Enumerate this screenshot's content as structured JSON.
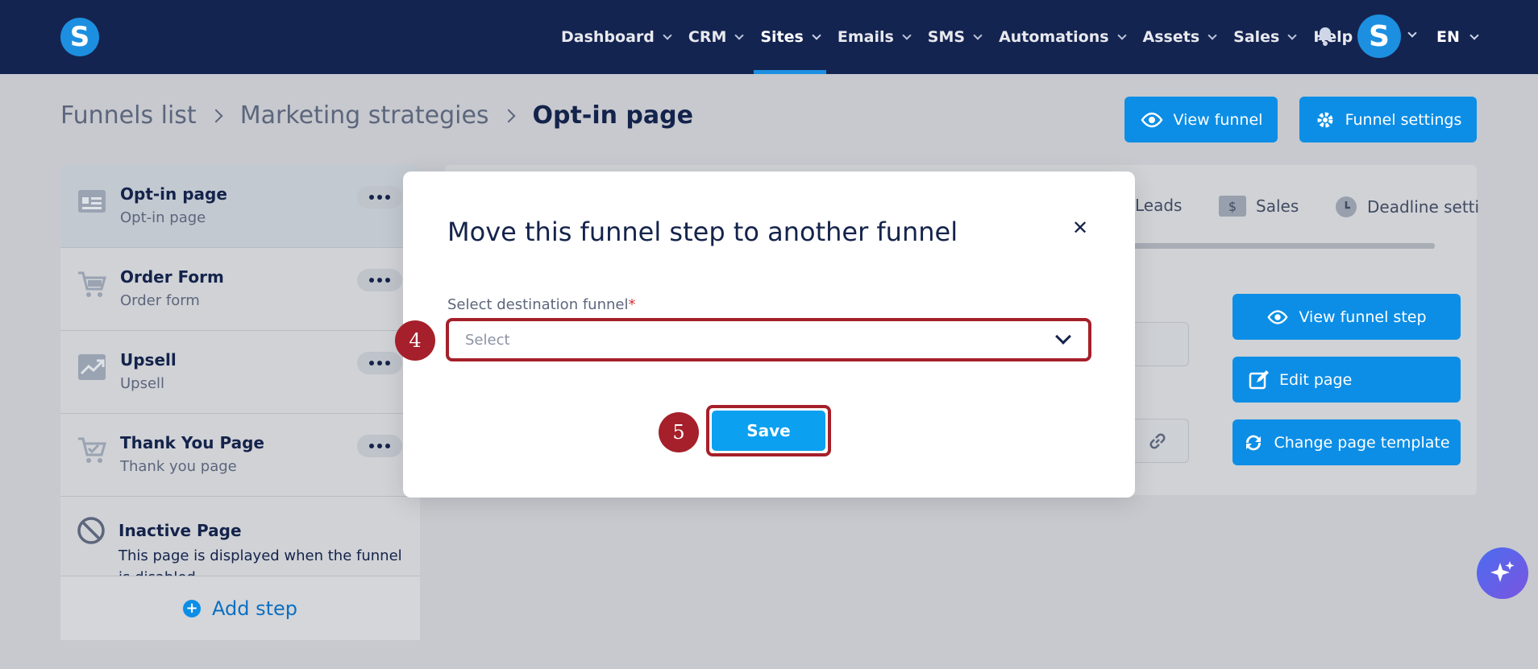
{
  "nav": {
    "logo": "S",
    "items": [
      {
        "label": "Dashboard",
        "dropdown": true
      },
      {
        "label": "CRM",
        "dropdown": true
      },
      {
        "label": "Sites",
        "dropdown": true,
        "active": true
      },
      {
        "label": "Emails",
        "dropdown": true
      },
      {
        "label": "SMS",
        "dropdown": true
      },
      {
        "label": "Automations",
        "dropdown": true
      },
      {
        "label": "Assets",
        "dropdown": true
      },
      {
        "label": "Sales",
        "dropdown": true
      },
      {
        "label": "Help",
        "dropdown": false
      }
    ],
    "avatar": "S",
    "language": "EN"
  },
  "breadcrumb": {
    "items": [
      "Funnels list",
      "Marketing strategies"
    ],
    "current": "Opt-in page"
  },
  "header_buttons": {
    "view_funnel": "View funnel",
    "funnel_settings": "Funnel settings"
  },
  "sidebar": {
    "steps": [
      {
        "name": "Opt-in page",
        "sub": "Opt-in page",
        "icon": "page-icon"
      },
      {
        "name": "Order Form",
        "sub": "Order form",
        "icon": "cart-icon"
      },
      {
        "name": "Upsell",
        "sub": "Upsell",
        "icon": "chart-icon"
      },
      {
        "name": "Thank You Page",
        "sub": "Thank you page",
        "icon": "cart-check-icon"
      }
    ],
    "inactive": {
      "name": "Inactive Page",
      "sub": "This page is displayed when the funnel is disabled"
    },
    "add_step": "Add step"
  },
  "tabs": {
    "leads": "Leads",
    "sales": "Sales",
    "deadline": "Deadline setti"
  },
  "actions": {
    "view_step": "View funnel step",
    "edit_page": "Edit page",
    "change_template": "Change page template"
  },
  "modal": {
    "title": "Move this funnel step to another funnel",
    "field_label": "Select destination funnel",
    "required_mark": "*",
    "select_placeholder": "Select",
    "save": "Save"
  },
  "annotations": {
    "badge_select": "4",
    "badge_save": "5"
  },
  "colors": {
    "nav_bg": "#142451",
    "accent": "#0c8ee6",
    "highlight": "#a5202a"
  }
}
